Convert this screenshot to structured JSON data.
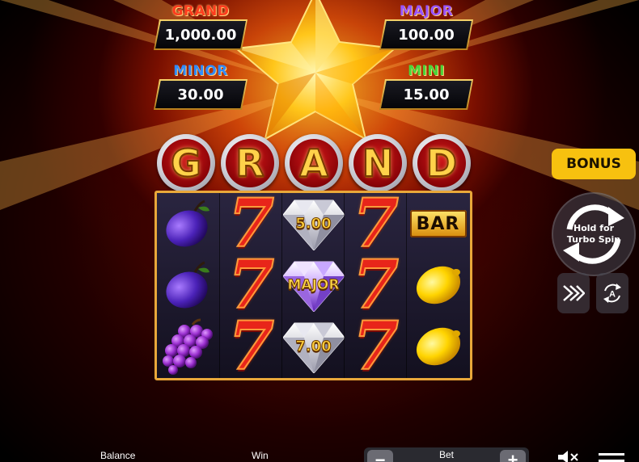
{
  "jackpots": {
    "grand": {
      "name": "GRAND",
      "value": "1,000.00"
    },
    "major": {
      "name": "MAJOR",
      "value": "100.00"
    },
    "minor": {
      "name": "MINOR",
      "value": "30.00"
    },
    "mini": {
      "name": "MINI",
      "value": "15.00"
    }
  },
  "title_letters": [
    "G",
    "R",
    "A",
    "N",
    "D"
  ],
  "reels": [
    [
      {
        "symbol": "plum-icon"
      },
      {
        "symbol": "plum-icon"
      },
      {
        "symbol": "grapes-icon"
      }
    ],
    [
      {
        "symbol": "seven",
        "text": "7"
      },
      {
        "symbol": "seven",
        "text": "7"
      },
      {
        "symbol": "seven",
        "text": "7"
      }
    ],
    [
      {
        "symbol": "diamond",
        "text": "5.00"
      },
      {
        "symbol": "diamond-purple",
        "text": "MAJOR"
      },
      {
        "symbol": "diamond",
        "text": "7.00"
      }
    ],
    [
      {
        "symbol": "seven",
        "text": "7"
      },
      {
        "symbol": "seven",
        "text": "7"
      },
      {
        "symbol": "seven",
        "text": "7"
      }
    ],
    [
      {
        "symbol": "bar",
        "text": "BAR"
      },
      {
        "symbol": "lemon-icon"
      },
      {
        "symbol": "lemon-icon"
      }
    ]
  ],
  "controls": {
    "bonus_label": "BONUS",
    "spin_line1": "Hold for",
    "spin_line2": "Turbo Spin",
    "auto_letter": "A"
  },
  "bottom": {
    "balance_label": "Balance",
    "win_label": "Win",
    "bet_label": "Bet",
    "bet_minus": "−",
    "bet_plus": "+"
  },
  "colors": {
    "accent_gold": "#f7c10f",
    "grand": "#ff3c1e",
    "major": "#9a55ff",
    "minor": "#2f8cff",
    "mini": "#4ad63a"
  }
}
